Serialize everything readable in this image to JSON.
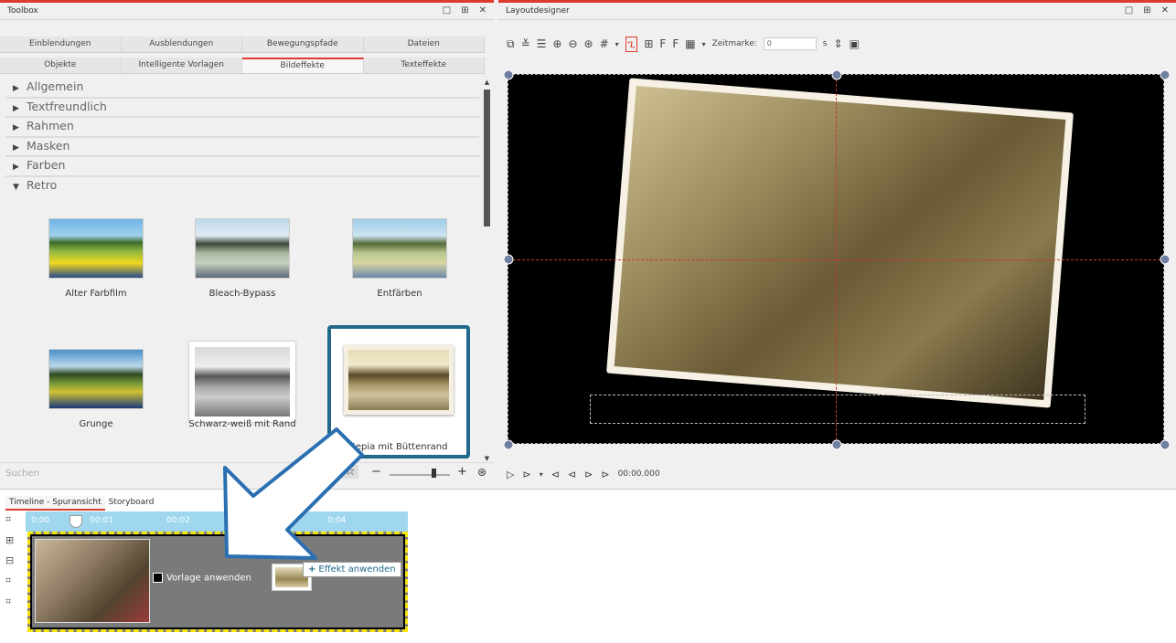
{
  "toolbox": {
    "title": "Toolbox",
    "controls": [
      "□",
      "⊞",
      "✕"
    ],
    "tabs_row1": [
      "Einblendungen",
      "Ausblendungen",
      "Bewegungspfade",
      "Dateien"
    ],
    "tabs_row2": [
      "Objekte",
      "Intelligente Vorlagen",
      "Bildeffekte",
      "Texteffekte"
    ],
    "active_tab": "Bildeffekte",
    "categories": [
      {
        "label": "Allgemein",
        "expanded": false
      },
      {
        "label": "Textfreundlich",
        "expanded": false
      },
      {
        "label": "Rahmen",
        "expanded": false
      },
      {
        "label": "Masken",
        "expanded": false
      },
      {
        "label": "Farben",
        "expanded": false
      },
      {
        "label": "Retro",
        "expanded": true
      }
    ],
    "effects": [
      {
        "label": "Alter Farbfilm",
        "selected": false
      },
      {
        "label": "Bleach-Bypass",
        "selected": false
      },
      {
        "label": "Entfärben",
        "selected": false
      },
      {
        "label": "Grunge",
        "selected": false
      },
      {
        "label": "Schwarz-weiß mit Rand",
        "selected": false
      },
      {
        "label": "Sepia mit Büttenrand",
        "selected": true
      }
    ],
    "search_placeholder": "Suchen"
  },
  "layoutdesigner": {
    "title": "Layoutdesigner",
    "controls": [
      "□",
      "⊞",
      "✕"
    ],
    "zeitmarke_label": "Zeitmarke:",
    "zeitmarke_value": "0",
    "zeitmarke_unit": "s",
    "timecode": "00:00.000"
  },
  "timeline": {
    "tabs": [
      "Timeline - Spuransicht",
      "Storyboard"
    ],
    "active_tab": "Timeline - Spuransicht",
    "ruler_labels": [
      "0:00",
      "00:01",
      "00:02",
      "0:04"
    ],
    "clip_label": "Vorlage anwenden",
    "tooltip": "Effekt anwenden"
  },
  "colors": {
    "accent_red": "#e0392d",
    "selection_blue": "#21688a",
    "ruler_cyan": "#9fd8ee",
    "clip_border_yellow": "#f6e60a"
  },
  "icons": [
    "rotate-icon",
    "zoom-in-icon",
    "zoom-out-icon",
    "grid-icon",
    "path-icon",
    "play-icon",
    "star-icon",
    "eye-icon",
    "minus-icon",
    "plus-icon",
    "search-icon"
  ]
}
